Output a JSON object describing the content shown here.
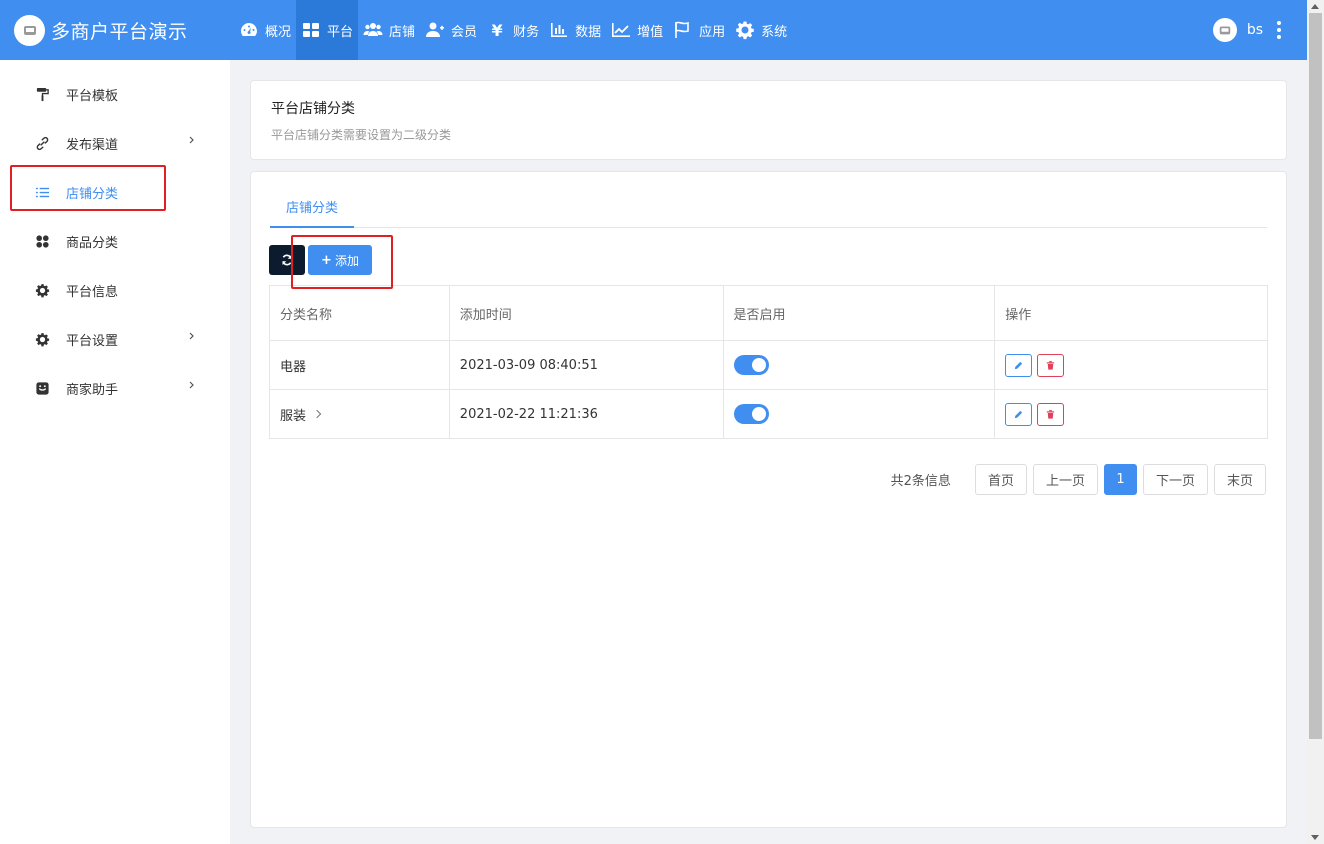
{
  "brand": {
    "name": "多商户平台演示"
  },
  "topnav": {
    "items": [
      {
        "label": "概况",
        "icon": "dashboard-icon"
      },
      {
        "label": "平台",
        "icon": "grid-icon"
      },
      {
        "label": "店铺",
        "icon": "users-icon"
      },
      {
        "label": "会员",
        "icon": "user-plus-icon"
      },
      {
        "label": "财务",
        "icon": "yen-icon"
      },
      {
        "label": "数据",
        "icon": "bar-chart-icon"
      },
      {
        "label": "增值",
        "icon": "line-chart-icon"
      },
      {
        "label": "应用",
        "icon": "flag-icon"
      },
      {
        "label": "系统",
        "icon": "gear-icon"
      }
    ],
    "active_index": 1,
    "user": "bs"
  },
  "sidebar": {
    "items": [
      {
        "label": "平台模板",
        "icon": "paint-roller-icon",
        "has_submenu": false
      },
      {
        "label": "发布渠道",
        "icon": "link-icon",
        "has_submenu": true
      },
      {
        "label": "店铺分类",
        "icon": "list-icon",
        "has_submenu": false
      },
      {
        "label": "商品分类",
        "icon": "apps-icon",
        "has_submenu": false
      },
      {
        "label": "平台信息",
        "icon": "gear-icon",
        "has_submenu": false
      },
      {
        "label": "平台设置",
        "icon": "gear-icon",
        "has_submenu": true
      },
      {
        "label": "商家助手",
        "icon": "smile-icon",
        "has_submenu": true
      }
    ],
    "active_index": 2
  },
  "header_card": {
    "title": "平台店铺分类",
    "subtitle": "平台店铺分类需要设置为二级分类"
  },
  "tabs": [
    {
      "label": "店铺分类"
    }
  ],
  "toolbar": {
    "add_label": "添加"
  },
  "table": {
    "columns": [
      "分类名称",
      "添加时间",
      "是否启用",
      "操作"
    ],
    "rows": [
      {
        "name": "电器",
        "time": "2021-03-09 08:40:51",
        "enabled": true,
        "expandable": false
      },
      {
        "name": "服装",
        "time": "2021-02-22 11:21:36",
        "enabled": true,
        "expandable": true
      }
    ]
  },
  "pagination": {
    "total_text": "共2条信息",
    "first": "首页",
    "prev": "上一页",
    "current": "1",
    "next": "下一页",
    "last": "末页"
  },
  "colors": {
    "primary": "#3f8ef0",
    "highlight": "#e02020",
    "dark_button": "#0d1b2e",
    "danger": "#e0405a"
  }
}
